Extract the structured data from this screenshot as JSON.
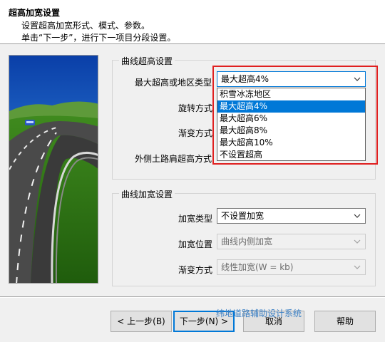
{
  "header": {
    "title": "超高加宽设置",
    "line1": "设置超高加宽形式、模式、参数。",
    "line2": "单击“下一步”，进行下一项目分段设置。"
  },
  "superelevation": {
    "group_title": "曲线超高设置",
    "max_label": "最大超高或地区类型",
    "max_value": "最大超高4%",
    "rotation_label": "旋转方式",
    "transition_label": "渐变方式",
    "shoulder_label": "外侧土路肩超高方式",
    "options": [
      "积雪冰冻地区",
      "最大超高4%",
      "最大超高6%",
      "最大超高8%",
      "最大超高10%",
      "不设置超高"
    ],
    "selected_index": 1
  },
  "widening": {
    "group_title": "曲线加宽设置",
    "type_label": "加宽类型",
    "type_value": "不设置加宽",
    "position_label": "加宽位置",
    "position_value": "曲线内侧加宽",
    "transition_label": "渐变方式",
    "transition_value": "线性加宽(W = kb)"
  },
  "buttons": {
    "back": "< 上一步(B)",
    "next": "下一步(N) >",
    "cancel": "取消",
    "help": "帮助"
  },
  "watermark": "纬地道路辅助设计系统",
  "colors": {
    "highlight": "#0078d7",
    "annotation": "#e02020"
  }
}
